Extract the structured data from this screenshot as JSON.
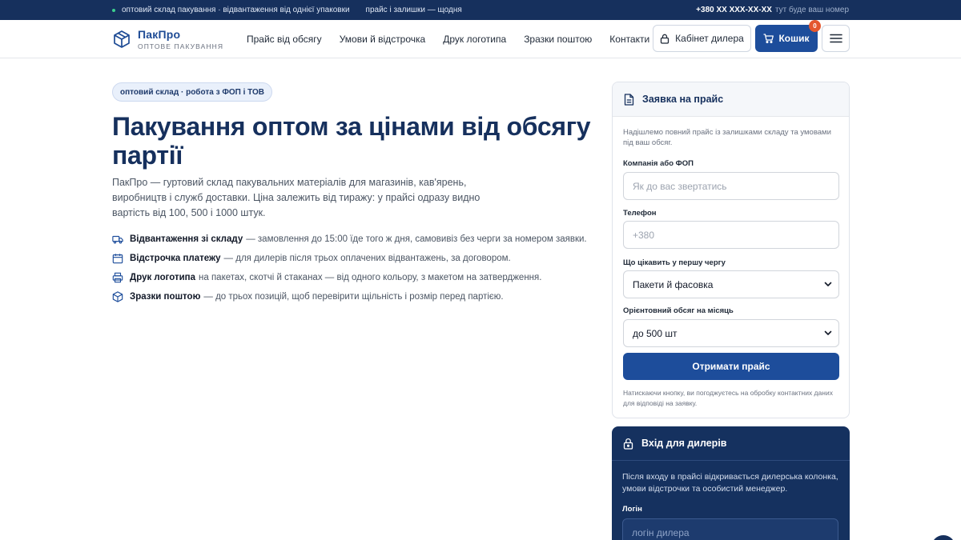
{
  "topbar": {
    "left_1": "оптовий склад пакування · відвантаження від однієї упаковки",
    "left_2": "прайс і залишки — щодня",
    "phone": "+380 XX XXX-XX-XX",
    "phone_note": "тут буде ваш номер"
  },
  "header": {
    "brand": "ПакПро",
    "brand_sub": "ОПТОВЕ ПАКУВАННЯ",
    "nav": [
      "Прайс від обсягу",
      "Умови й відстрочка",
      "Друк логотипа",
      "Зразки поштою",
      "Контакти"
    ],
    "dealer_button": "Кабінет дилера",
    "cart_button": "Кошик",
    "cart_count": "0"
  },
  "hero": {
    "badge": "оптовий склад · робота з ФОП і ТОВ",
    "title": "Пакування оптом за цінами від обсягу партії",
    "intro": "ПакПро — гуртовий склад пакувальних матеріалів для магазинів, кав'ярень, виробництв і служб доставки. Ціна залежить від тиражу: у прайсі одразу видно вартість від 100, 500 і 1000 штук.",
    "features": [
      {
        "icon": "truck-icon",
        "title": "Відвантаження зі складу",
        "text": "— замовлення до 15:00 їде того ж дня, самовивіз без черги за номером заявки."
      },
      {
        "icon": "calendar-icon",
        "title": "Відстрочка платежу",
        "text": "— для дилерів після трьох оплачених відвантажень, за договором."
      },
      {
        "icon": "printer-icon",
        "title": "Друк логотипа",
        "text": "на пакетах, скотчі й стаканах — від одного кольору, з макетом на затвердження."
      },
      {
        "icon": "cube-icon",
        "title": "Зразки поштою",
        "text": "— до трьох позицій, щоб перевірити щільність і розмір перед партією."
      }
    ]
  },
  "price_form": {
    "title": "Заявка на прайс",
    "note": "Надішлемо повний прайс із залишками складу та умовами під ваш обсяг.",
    "company_label": "Компанія або ФОП",
    "company_placeholder": "Як до вас звертатись",
    "phone_label": "Телефон",
    "phone_placeholder": "+380",
    "interest_label": "Що цікавить у першу чергу",
    "interest_value": "Пакети й фасовка",
    "volume_label": "Орієнтовний обсяг на місяць",
    "volume_value": "до 500 шт",
    "submit": "Отримати прайс",
    "consent": "Натискаючи кнопку, ви погоджуєтесь на обробку контактних даних для відповіді на заявку."
  },
  "dealer_login": {
    "title": "Вхід для дилерів",
    "note": "Після входу в прайсі відкривається дилерська колонка, умови відстрочки та особистий менеджер.",
    "login_label": "Логін",
    "login_placeholder": "логін дилера"
  },
  "colors": {
    "brand_navy": "#16305d",
    "accent_blue": "#1d4d9b",
    "badge_red": "#e4572e",
    "online_green": "#3ccf8e"
  }
}
